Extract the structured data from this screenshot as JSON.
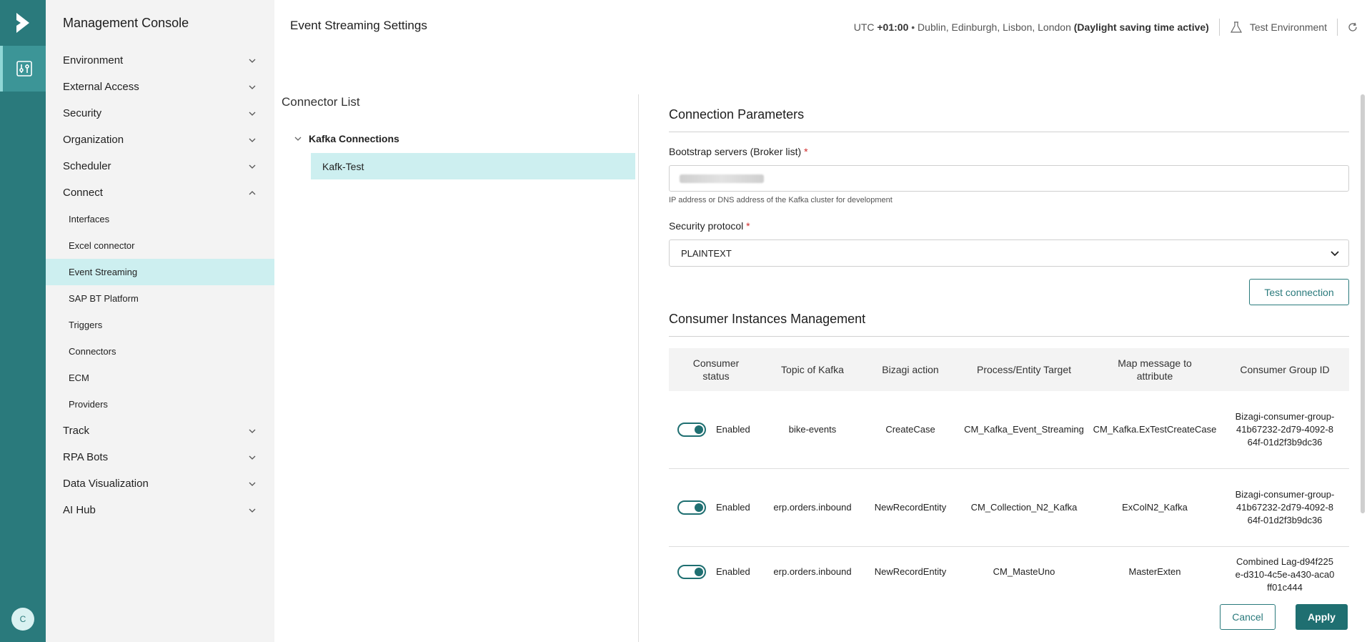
{
  "app": {
    "title": "Management Console",
    "avatar_initial": "C"
  },
  "sidebar": {
    "items": [
      {
        "label": "Environment",
        "expanded": false
      },
      {
        "label": "External Access",
        "expanded": false
      },
      {
        "label": "Security",
        "expanded": false
      },
      {
        "label": "Organization",
        "expanded": false
      },
      {
        "label": "Scheduler",
        "expanded": false
      },
      {
        "label": "Connect",
        "expanded": true
      },
      {
        "label": "Track",
        "expanded": false
      },
      {
        "label": "RPA Bots",
        "expanded": false
      },
      {
        "label": "Data Visualization",
        "expanded": false
      },
      {
        "label": "AI Hub",
        "expanded": false
      }
    ],
    "connect_sub": [
      {
        "label": "Interfaces"
      },
      {
        "label": "Excel connector"
      },
      {
        "label": "Event Streaming",
        "active": true
      },
      {
        "label": "SAP BT Platform"
      },
      {
        "label": "Triggers"
      },
      {
        "label": "Connectors"
      },
      {
        "label": "ECM"
      },
      {
        "label": "Providers"
      }
    ]
  },
  "header": {
    "page_title": "Event Streaming Settings",
    "tz_prefix": "UTC",
    "tz_offset": "+01:00",
    "tz_cities": "• Dublin, Edinburgh, Lisbon, London",
    "tz_dst": "(Daylight saving time active)",
    "environment": "Test Environment"
  },
  "connectors": {
    "title": "Connector List",
    "group": "Kafka Connections",
    "item": "Kafk-Test"
  },
  "connection": {
    "title": "Connection Parameters",
    "bootstrap_label": "Bootstrap servers (Broker list)",
    "required_mark": "*",
    "bootstrap_hint": "IP address or DNS address of the Kafka cluster for development",
    "security_label": "Security protocol",
    "security_value": "PLAINTEXT",
    "test_button": "Test connection"
  },
  "consumers": {
    "title": "Consumer Instances Management",
    "columns": [
      "Consumer status",
      "Topic of Kafka",
      "Bizagi action",
      "Process/Entity Target",
      "Map message to attribute",
      "Consumer Group ID"
    ],
    "rows": [
      {
        "status": "Enabled",
        "topic": "bike-events",
        "action": "CreateCase",
        "target": "CM_Kafka_Event_Streaming",
        "map": "CM_Kafka.ExTestCreateCase",
        "group": "Bizagi-consumer-group-41b67232-2d79-4092-864f-01d2f3b9dc36"
      },
      {
        "status": "Enabled",
        "topic": "erp.orders.inbound",
        "action": "NewRecordEntity",
        "target": "CM_Collection_N2_Kafka",
        "map": "ExColN2_Kafka",
        "group": "Bizagi-consumer-group-41b67232-2d79-4092-864f-01d2f3b9dc36"
      },
      {
        "status": "Enabled",
        "topic": "erp.orders.inbound",
        "action": "NewRecordEntity",
        "target": "CM_MasteUno",
        "map": "MasterExten",
        "group": "Combined Lag-d94f225e-d310-4c5e-a430-aca0ff01c444"
      }
    ]
  },
  "footer": {
    "cancel": "Cancel",
    "apply": "Apply"
  }
}
